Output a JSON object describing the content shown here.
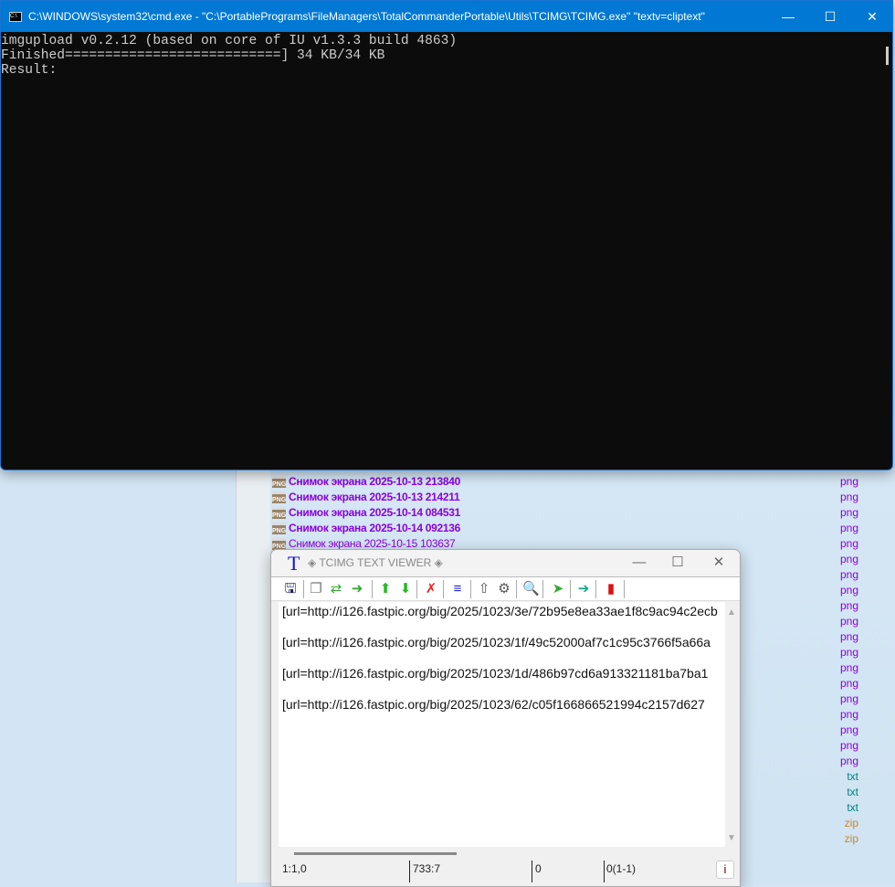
{
  "cmd": {
    "title": "C:\\WINDOWS\\system32\\cmd.exe - \"C:\\PortablePrograms\\FileManagers\\TotalCommanderPortable\\Utils\\TCIMG\\TCIMG.exe\"  \"textv=cliptext\"",
    "lines": [
      "imgupload v0.2.12 (based on core of IU v1.3.3 build 4863)",
      "Finished===========================] 34 KB/34 KB",
      "Result:"
    ]
  },
  "files": [
    {
      "name": "Снимок экрана 2025-10-13 213840",
      "ext": "png",
      "bold": true
    },
    {
      "name": "Снимок экрана 2025-10-13 214211",
      "ext": "png",
      "bold": true
    },
    {
      "name": "Снимок экрана 2025-10-14 084531",
      "ext": "png",
      "bold": true
    },
    {
      "name": "Снимок экрана 2025-10-14 092136",
      "ext": "png",
      "bold": true
    },
    {
      "name": "Снимок экрана 2025-10-15 103637",
      "ext": "png",
      "bold": false
    },
    {
      "name": "",
      "ext": "png"
    },
    {
      "name": "",
      "ext": "png"
    },
    {
      "name": "",
      "ext": "png"
    },
    {
      "name": "",
      "ext": "png"
    },
    {
      "name": "",
      "ext": "png"
    },
    {
      "name": "",
      "ext": "png"
    },
    {
      "name": "",
      "ext": "png"
    },
    {
      "name": "",
      "ext": "png"
    },
    {
      "name": "",
      "ext": "png"
    },
    {
      "name": "",
      "ext": "png"
    },
    {
      "name": "",
      "ext": "png"
    },
    {
      "name": "",
      "ext": "png"
    },
    {
      "name": "",
      "ext": "png"
    },
    {
      "name": "",
      "ext": "png"
    },
    {
      "name": "",
      "ext": "txt"
    },
    {
      "name": "",
      "ext": "txt"
    },
    {
      "name": "",
      "ext": "txt"
    },
    {
      "name": "",
      "ext": "zip"
    },
    {
      "name": "",
      "ext": "zip"
    }
  ],
  "viewer": {
    "title": "◈ TCIMG TEXT VIEWER ◈",
    "lines": [
      "[url=http://i126.fastpic.org/big/2025/1023/3e/72b95e8ea33ae1f8c9ac94c2ecb",
      "[url=http://i126.fastpic.org/big/2025/1023/1f/49c52000af7c1c95c3766f5a66a",
      "[url=http://i126.fastpic.org/big/2025/1023/1d/486b97cd6a913321181ba7ba1",
      "[url=http://i126.fastpic.org/big/2025/1023/62/c05f166866521994c2157d627"
    ],
    "status": {
      "pos": "1:1,0",
      "size": "733:7",
      "sel": "0",
      "count": "0(1-1)",
      "info": "i"
    }
  },
  "toolbar_icons": [
    "save-icon",
    "copy-icon",
    "paste-replace-icon",
    "paste-icon",
    "move-up-icon",
    "move-down-icon",
    "delete-icon",
    "sort-icon",
    "upload-icon",
    "settings-icon",
    "search-icon",
    "pin-icon",
    "go-icon",
    "exit-icon"
  ]
}
